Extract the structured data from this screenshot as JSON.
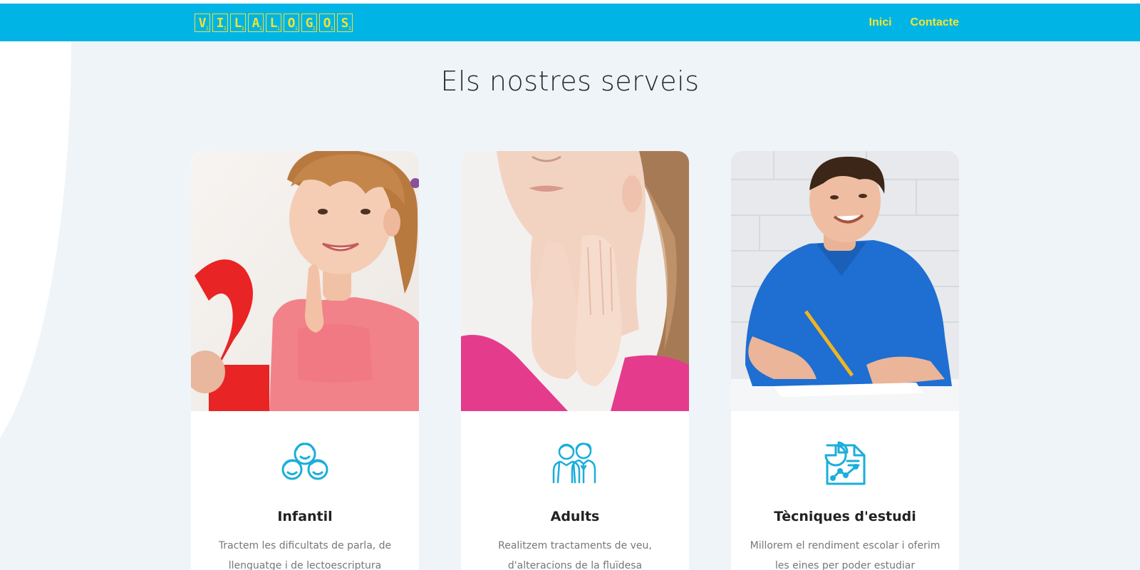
{
  "header": {
    "logo_letters": [
      "V",
      "I",
      "L",
      "A",
      "L",
      "O",
      "G",
      "O",
      "S"
    ],
    "nav": [
      {
        "label": "Inici"
      },
      {
        "label": "Contacte"
      }
    ]
  },
  "main": {
    "title": "Els nostres serveis",
    "cards": [
      {
        "title": "Infantil",
        "description": "Tractem les dificultats de parla, de llenguatge i de lectoescriptura",
        "icon": "children-icon"
      },
      {
        "title": "Adults",
        "description": "Realitzem tractaments de veu, d'alteracions de la fluïdesa",
        "icon": "adults-icon"
      },
      {
        "title": "Tècniques d'estudi",
        "description": "Millorem el rendiment escolar i oferim les eines per poder estudiar",
        "icon": "study-report-icon"
      }
    ]
  },
  "colors": {
    "header_bg": "#00b4e6",
    "accent_yellow": "#f5e52d",
    "page_bg": "#eff4f8",
    "icon_blue": "#1aaedb"
  }
}
